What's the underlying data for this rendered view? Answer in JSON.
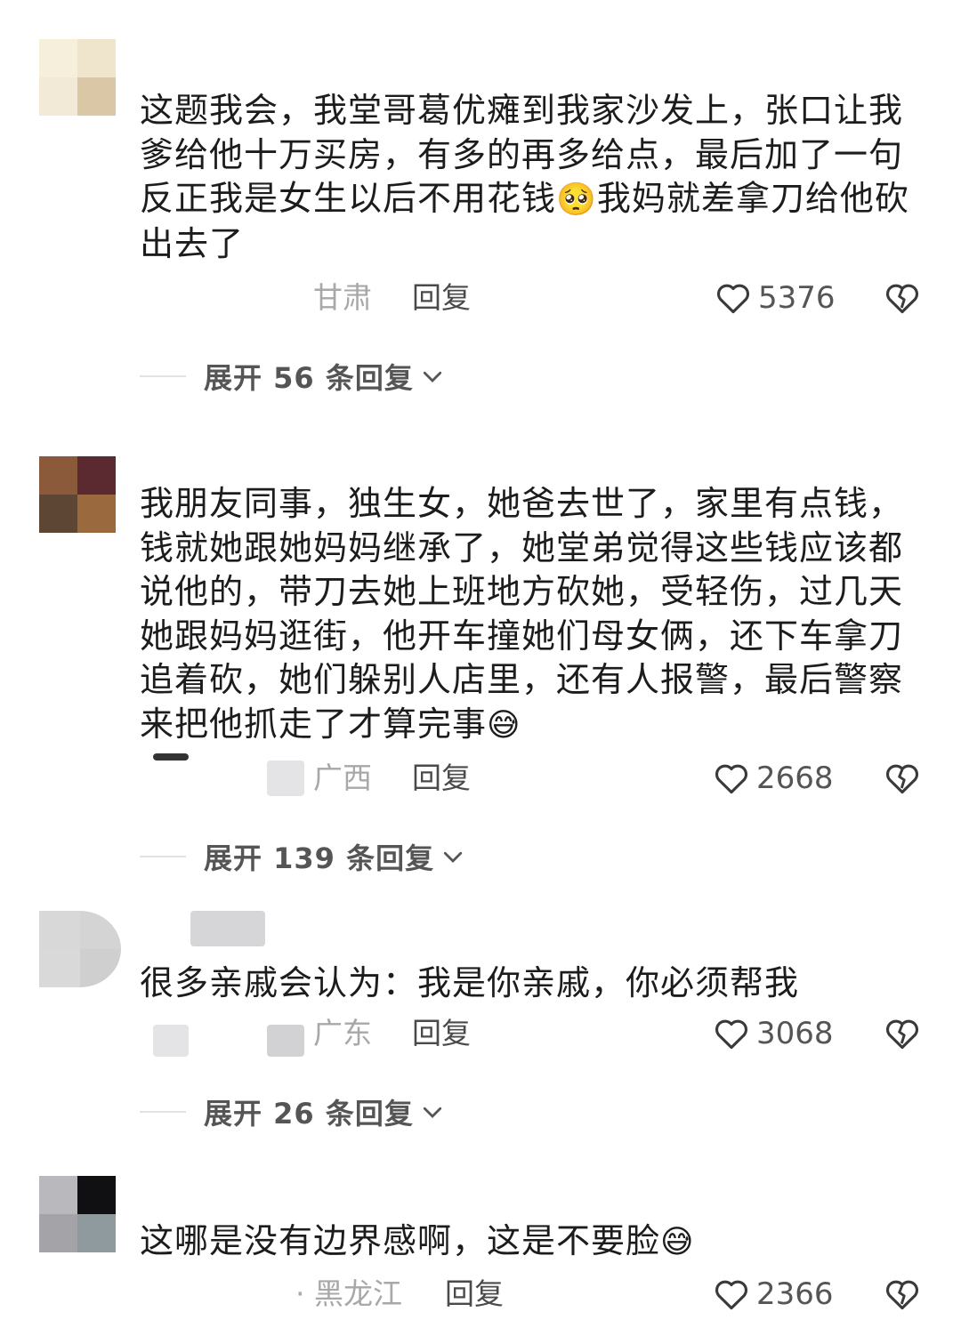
{
  "comments": [
    {
      "text": "这题我会，我堂哥葛优瘫到我家沙发上，张口让我爹给他十万买房，有多的再多给点，最后加了一句反正我是女生以后不用花钱",
      "emoji": "🥺",
      "text_after": "我妈就差拿刀给他砍出去了",
      "location": "甘肃",
      "reply_label": "回复",
      "likes": "5376",
      "expand_label": "展开 56 条回复",
      "avatar_colors": [
        "#f6efdc",
        "#efe5cc",
        "#f2e9d6",
        "#d9c7a6"
      ]
    },
    {
      "text": "我朋友同事，独生女，她爸去世了，家里有点钱，钱就她跟她妈妈继承了，她堂弟觉得这些钱应该都说他的，带刀去她上班地方砍她，受轻伤，过几天她跟妈妈逛街，他开车撞她们母女俩，还下车拿刀追着砍，她们躲别人店里，还有人报警，最后警察来把他抓走了才算完事",
      "emoji": "😅",
      "location": "广西",
      "reply_label": "回复",
      "likes": "2668",
      "expand_label": "展开 139 条回复",
      "avatar_colors": [
        "#8a5a3a",
        "#5a2a30",
        "#5e4634",
        "#9a6a3e"
      ]
    },
    {
      "text": "很多亲戚会认为：我是你亲戚，你必须帮我",
      "location": "广东",
      "reply_label": "回复",
      "likes": "3068",
      "expand_label": "展开 26 条回复",
      "avatar_colors": [
        "#d8d8d8",
        "#d4d4d4",
        "#d9d9d9",
        "#cfcfcf"
      ]
    },
    {
      "text": "这哪是没有边界感啊，这是不要脸",
      "emoji": "😅",
      "location": "· 黑龙江",
      "reply_label": "回复",
      "likes": "2366",
      "avatar_colors": [
        "#b9b9bd",
        "#101012",
        "#a3a3a8",
        "#8e9a9e"
      ]
    }
  ],
  "icons": {
    "like": "heart-outline-icon",
    "dislike": "broken-heart-icon",
    "expand": "chevron-down-icon"
  }
}
